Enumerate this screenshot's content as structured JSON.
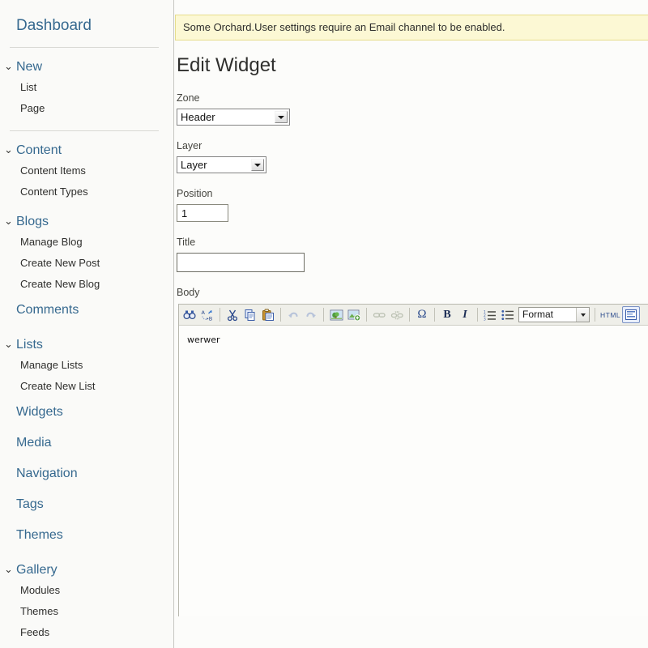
{
  "sidebar": {
    "dashboard_label": "Dashboard",
    "groups": [
      {
        "label": "New",
        "icon": "chevron-down-icon",
        "expanded": true,
        "items": [
          "List",
          "Page"
        ]
      },
      {
        "label": "Content",
        "icon": "chevron-down-icon",
        "expanded": true,
        "items": [
          "Content Items",
          "Content Types"
        ]
      },
      {
        "label": "Blogs",
        "icon": "chevron-down-icon",
        "expanded": true,
        "items": [
          "Manage Blog",
          "Create New Post",
          "Create New Blog"
        ]
      }
    ],
    "comments_label": "Comments",
    "lists_group": {
      "label": "Lists",
      "icon": "chevron-down-icon",
      "expanded": true,
      "items": [
        "Manage Lists",
        "Create New List"
      ]
    },
    "standalone": [
      "Widgets",
      "Media",
      "Navigation",
      "Tags",
      "Themes"
    ],
    "gallery_group": {
      "label": "Gallery",
      "icon": "chevron-down-icon",
      "expanded": true,
      "items": [
        "Modules",
        "Themes",
        "Feeds"
      ]
    }
  },
  "main": {
    "notice": "Some Orchard.User settings require an Email channel to be enabled.",
    "title": "Edit Widget",
    "fields": {
      "zone": {
        "label": "Zone",
        "value": "Header"
      },
      "layer": {
        "label": "Layer",
        "value": "Layer"
      },
      "position": {
        "label": "Position",
        "value": "1"
      },
      "title": {
        "label": "Title",
        "value": "",
        "placeholder": ""
      },
      "body": {
        "label": "Body",
        "content": "werwer"
      }
    }
  },
  "editor_toolbar": {
    "format_value": "Format",
    "html_label": "HTML",
    "buttons": [
      {
        "name": "find-icon",
        "title": "Find",
        "disabled": false
      },
      {
        "name": "replace-icon",
        "title": "Replace",
        "disabled": false
      },
      {
        "name": "cut-icon",
        "title": "Cut",
        "disabled": false
      },
      {
        "name": "copy-icon",
        "title": "Copy",
        "disabled": false
      },
      {
        "name": "paste-icon",
        "title": "Paste",
        "disabled": false
      },
      {
        "name": "undo-icon",
        "title": "Undo",
        "disabled": true
      },
      {
        "name": "redo-icon",
        "title": "Redo",
        "disabled": true
      },
      {
        "name": "image-icon",
        "title": "Image",
        "disabled": false
      },
      {
        "name": "insert-media-icon",
        "title": "Insert Media",
        "disabled": false
      },
      {
        "name": "link-icon",
        "title": "Link",
        "disabled": true
      },
      {
        "name": "unlink-icon",
        "title": "Unlink",
        "disabled": true
      },
      {
        "name": "special-character-icon",
        "title": "Special Character",
        "disabled": false
      },
      {
        "name": "bold-icon",
        "title": "Bold",
        "disabled": false
      },
      {
        "name": "italic-icon",
        "title": "Italic",
        "disabled": false
      },
      {
        "name": "numbered-list-icon",
        "title": "Numbered List",
        "disabled": false
      },
      {
        "name": "bulleted-list-icon",
        "title": "Bulleted List",
        "disabled": false
      },
      {
        "name": "source-html-icon",
        "title": "HTML Source",
        "disabled": false
      },
      {
        "name": "show-blocks-icon",
        "title": "Show Blocks",
        "disabled": false
      }
    ],
    "labels": {
      "bold": "B",
      "italic": "I",
      "omega": "Ω"
    }
  },
  "colors": {
    "link": "#36698f",
    "notice_bg": "#fcf8d4",
    "notice_border": "#e6dd8c",
    "page_bg": "#fafaf8",
    "toolbar_bg": "#efefe9"
  }
}
